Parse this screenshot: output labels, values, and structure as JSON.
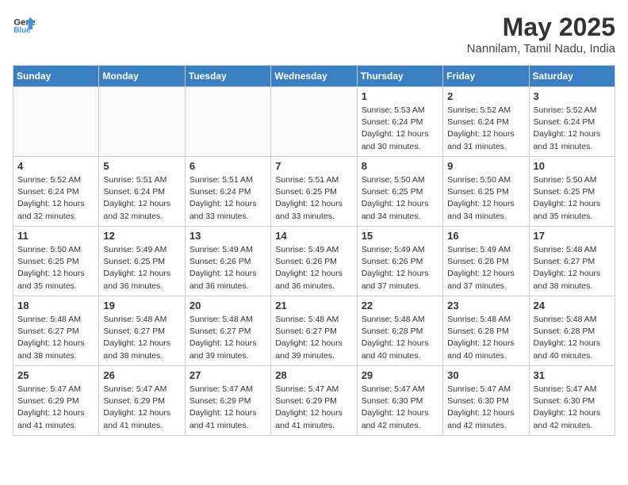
{
  "logo": {
    "text_general": "General",
    "text_blue": "Blue"
  },
  "title": {
    "month_year": "May 2025",
    "location": "Nannilam, Tamil Nadu, India"
  },
  "days_of_week": [
    "Sunday",
    "Monday",
    "Tuesday",
    "Wednesday",
    "Thursday",
    "Friday",
    "Saturday"
  ],
  "weeks": [
    [
      {
        "day": "",
        "info": ""
      },
      {
        "day": "",
        "info": ""
      },
      {
        "day": "",
        "info": ""
      },
      {
        "day": "",
        "info": ""
      },
      {
        "day": "1",
        "info": "Sunrise: 5:53 AM\nSunset: 6:24 PM\nDaylight: 12 hours\nand 30 minutes."
      },
      {
        "day": "2",
        "info": "Sunrise: 5:52 AM\nSunset: 6:24 PM\nDaylight: 12 hours\nand 31 minutes."
      },
      {
        "day": "3",
        "info": "Sunrise: 5:52 AM\nSunset: 6:24 PM\nDaylight: 12 hours\nand 31 minutes."
      }
    ],
    [
      {
        "day": "4",
        "info": "Sunrise: 5:52 AM\nSunset: 6:24 PM\nDaylight: 12 hours\nand 32 minutes."
      },
      {
        "day": "5",
        "info": "Sunrise: 5:51 AM\nSunset: 6:24 PM\nDaylight: 12 hours\nand 32 minutes."
      },
      {
        "day": "6",
        "info": "Sunrise: 5:51 AM\nSunset: 6:24 PM\nDaylight: 12 hours\nand 33 minutes."
      },
      {
        "day": "7",
        "info": "Sunrise: 5:51 AM\nSunset: 6:25 PM\nDaylight: 12 hours\nand 33 minutes."
      },
      {
        "day": "8",
        "info": "Sunrise: 5:50 AM\nSunset: 6:25 PM\nDaylight: 12 hours\nand 34 minutes."
      },
      {
        "day": "9",
        "info": "Sunrise: 5:50 AM\nSunset: 6:25 PM\nDaylight: 12 hours\nand 34 minutes."
      },
      {
        "day": "10",
        "info": "Sunrise: 5:50 AM\nSunset: 6:25 PM\nDaylight: 12 hours\nand 35 minutes."
      }
    ],
    [
      {
        "day": "11",
        "info": "Sunrise: 5:50 AM\nSunset: 6:25 PM\nDaylight: 12 hours\nand 35 minutes."
      },
      {
        "day": "12",
        "info": "Sunrise: 5:49 AM\nSunset: 6:25 PM\nDaylight: 12 hours\nand 36 minutes."
      },
      {
        "day": "13",
        "info": "Sunrise: 5:49 AM\nSunset: 6:26 PM\nDaylight: 12 hours\nand 36 minutes."
      },
      {
        "day": "14",
        "info": "Sunrise: 5:49 AM\nSunset: 6:26 PM\nDaylight: 12 hours\nand 36 minutes."
      },
      {
        "day": "15",
        "info": "Sunrise: 5:49 AM\nSunset: 6:26 PM\nDaylight: 12 hours\nand 37 minutes."
      },
      {
        "day": "16",
        "info": "Sunrise: 5:49 AM\nSunset: 6:26 PM\nDaylight: 12 hours\nand 37 minutes."
      },
      {
        "day": "17",
        "info": "Sunrise: 5:48 AM\nSunset: 6:27 PM\nDaylight: 12 hours\nand 38 minutes."
      }
    ],
    [
      {
        "day": "18",
        "info": "Sunrise: 5:48 AM\nSunset: 6:27 PM\nDaylight: 12 hours\nand 38 minutes."
      },
      {
        "day": "19",
        "info": "Sunrise: 5:48 AM\nSunset: 6:27 PM\nDaylight: 12 hours\nand 38 minutes."
      },
      {
        "day": "20",
        "info": "Sunrise: 5:48 AM\nSunset: 6:27 PM\nDaylight: 12 hours\nand 39 minutes."
      },
      {
        "day": "21",
        "info": "Sunrise: 5:48 AM\nSunset: 6:27 PM\nDaylight: 12 hours\nand 39 minutes."
      },
      {
        "day": "22",
        "info": "Sunrise: 5:48 AM\nSunset: 6:28 PM\nDaylight: 12 hours\nand 40 minutes."
      },
      {
        "day": "23",
        "info": "Sunrise: 5:48 AM\nSunset: 6:28 PM\nDaylight: 12 hours\nand 40 minutes."
      },
      {
        "day": "24",
        "info": "Sunrise: 5:48 AM\nSunset: 6:28 PM\nDaylight: 12 hours\nand 40 minutes."
      }
    ],
    [
      {
        "day": "25",
        "info": "Sunrise: 5:47 AM\nSunset: 6:29 PM\nDaylight: 12 hours\nand 41 minutes."
      },
      {
        "day": "26",
        "info": "Sunrise: 5:47 AM\nSunset: 6:29 PM\nDaylight: 12 hours\nand 41 minutes."
      },
      {
        "day": "27",
        "info": "Sunrise: 5:47 AM\nSunset: 6:29 PM\nDaylight: 12 hours\nand 41 minutes."
      },
      {
        "day": "28",
        "info": "Sunrise: 5:47 AM\nSunset: 6:29 PM\nDaylight: 12 hours\nand 41 minutes."
      },
      {
        "day": "29",
        "info": "Sunrise: 5:47 AM\nSunset: 6:30 PM\nDaylight: 12 hours\nand 42 minutes."
      },
      {
        "day": "30",
        "info": "Sunrise: 5:47 AM\nSunset: 6:30 PM\nDaylight: 12 hours\nand 42 minutes."
      },
      {
        "day": "31",
        "info": "Sunrise: 5:47 AM\nSunset: 6:30 PM\nDaylight: 12 hours\nand 42 minutes."
      }
    ]
  ]
}
